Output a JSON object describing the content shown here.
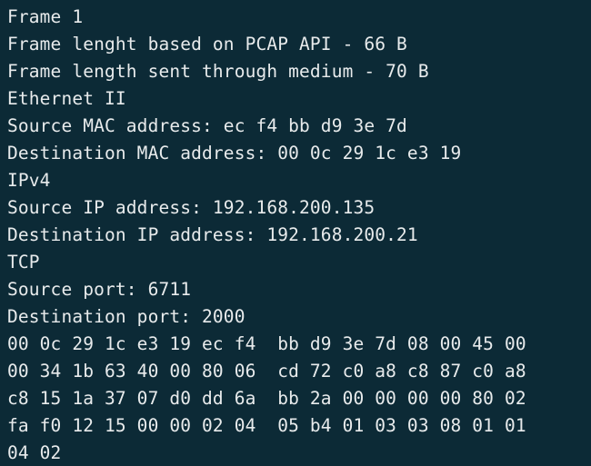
{
  "terminal": {
    "colors": {
      "background": "#0c2a36",
      "text": "#e8ebec"
    },
    "lines": [
      "Frame 1",
      "Frame lenght based on PCAP API - 66 B",
      "Frame length sent through medium - 70 B",
      "Ethernet II",
      "Source MAC address: ec f4 bb d9 3e 7d",
      "Destination MAC address: 00 0c 29 1c e3 19",
      "IPv4",
      "Source IP address: 192.168.200.135",
      "Destination IP address: 192.168.200.21",
      "TCP",
      "Source port: 6711",
      "Destination port: 2000",
      "00 0c 29 1c e3 19 ec f4  bb d9 3e 7d 08 00 45 00",
      "00 34 1b 63 40 00 80 06  cd 72 c0 a8 c8 87 c0 a8",
      "c8 15 1a 37 07 d0 dd 6a  bb 2a 00 00 00 00 80 02",
      "fa f0 12 15 00 00 02 04  05 b4 01 03 03 08 01 01",
      "04 02"
    ]
  }
}
